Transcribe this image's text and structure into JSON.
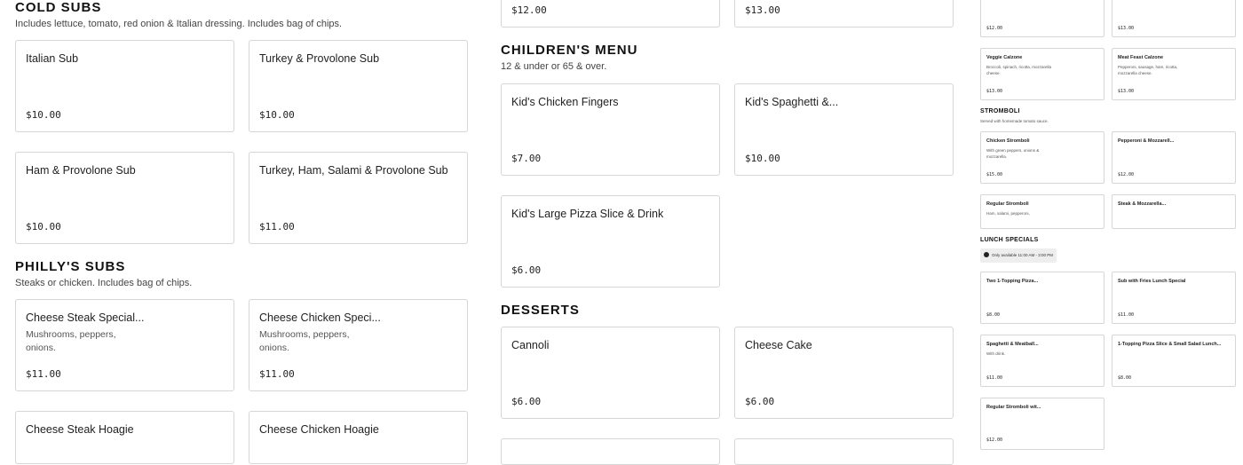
{
  "cold_subs": {
    "title": "COLD SUBS",
    "description": "Includes lettuce, tomato, red onion & Italian dressing. Includes bag of chips.",
    "items": [
      {
        "name": "Italian Sub",
        "price": "$10.00"
      },
      {
        "name": "Turkey & Provolone Sub",
        "price": "$10.00"
      },
      {
        "name": "Ham & Provolone Sub",
        "price": "$10.00"
      },
      {
        "name": "Turkey, Ham, Salami & Provolone Sub",
        "price": "$11.00"
      }
    ]
  },
  "phillys_subs": {
    "title": "PHILLY'S SUBS",
    "description": "Steaks or chicken. Includes bag of chips.",
    "items": [
      {
        "name": "Cheese Steak Special...",
        "desc": "Mushrooms, peppers, onions.",
        "price": "$11.00"
      },
      {
        "name": "Cheese Chicken Speci...",
        "desc": "Mushrooms, peppers, onions.",
        "price": "$11.00"
      },
      {
        "name": "Cheese Steak Hoagie",
        "desc": "",
        "price": ""
      },
      {
        "name": "Cheese Chicken Hoagie",
        "desc": "",
        "price": ""
      }
    ]
  },
  "middle_top": {
    "price_left": "$12.00",
    "price_right": "$13.00"
  },
  "childrens_menu": {
    "title": "CHILDREN'S MENU",
    "description": "12 & under or 65 & over.",
    "items": [
      {
        "name": "Kid's Chicken Fingers",
        "price": "$7.00"
      },
      {
        "name": "Kid's Spaghetti &...",
        "price": "$10.00"
      },
      {
        "name": "Kid's Large Pizza Slice & Drink",
        "price": "$6.00"
      }
    ]
  },
  "desserts": {
    "title": "DESSERTS",
    "items": [
      {
        "name": "Cannoli",
        "price": "$6.00"
      },
      {
        "name": "Cheese Cake",
        "price": "$6.00"
      }
    ]
  },
  "right_col": {
    "top_prices": [
      "$12.00",
      "$13.00"
    ],
    "calzones": [
      {
        "name": "Veggie Calzone",
        "desc": "Broccoli, spinach, ricotta, mozzarella cheese.",
        "price": "$13.00"
      },
      {
        "name": "Meat Feast Calzone",
        "desc": "Pepperoni, sausage, ham, ricotta, mozzarella cheese.",
        "price": "$13.00"
      }
    ],
    "stromboli": {
      "title": "STROMBOLI",
      "description": "Served with homemade tomato sauce.",
      "items": [
        {
          "name": "Chicken Stromboli",
          "desc": "With green peppers, onions & mozzarella.",
          "price": "$15.00"
        },
        {
          "name": "Pepperoni & Mozzarell...",
          "desc": "",
          "price": "$12.00"
        },
        {
          "name": "Regular Stromboli",
          "desc": "Ham, salami, pepperoni,",
          "price": ""
        },
        {
          "name": "Steak & Mozzarella...",
          "desc": "",
          "price": ""
        }
      ]
    },
    "lunch": {
      "title": "LUNCH SPECIALS",
      "availability": "Only available 11:00 AM - 3:00 PM",
      "items": [
        {
          "name": "Two 1-Topping Pizza...",
          "desc": "",
          "price": "$8.00"
        },
        {
          "name": "Sub with Fries Lunch Special",
          "desc": "",
          "price": "$11.00"
        },
        {
          "name": "Spaghetti & Meatball...",
          "desc": "With drink.",
          "price": "$11.00"
        },
        {
          "name": "1-Topping Pizza Slice & Small Salad Lunch...",
          "desc": "",
          "price": "$8.00"
        },
        {
          "name": "Regular Stromboli wit...",
          "desc": "",
          "price": "$12.00"
        }
      ]
    }
  }
}
